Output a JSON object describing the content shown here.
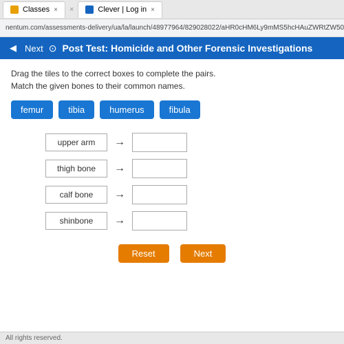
{
  "browser": {
    "tab1_favicon": "classes",
    "tab1_label": "Classes",
    "tab1_close": "×",
    "tab2_favicon": "clever",
    "tab2_label": "Clever | Log in",
    "tab2_close": "×",
    "address": "nentum.com/assessments-delivery/ua/la/launch/48977964/829028022/aHR0cHM6Ly9mMS5hcHAuZWRtZW50dW0"
  },
  "page": {
    "nav_back": "◀",
    "nav_label": "Next",
    "nav_icon": "⊙",
    "title": "Post Test: Homicide and Other Forensic Investigations"
  },
  "content": {
    "instruction_main": "Drag the tiles to the correct boxes to complete the pairs.",
    "instruction_sub": "Match the given bones to their common names.",
    "tiles": [
      {
        "id": "femur",
        "label": "femur"
      },
      {
        "id": "tibia",
        "label": "tibia"
      },
      {
        "id": "humerus",
        "label": "humerus"
      },
      {
        "id": "fibula",
        "label": "fibula"
      }
    ],
    "pairs": [
      {
        "id": "upper-arm",
        "label": "upper arm"
      },
      {
        "id": "thigh-bone",
        "label": "thigh bone"
      },
      {
        "id": "calf-bone",
        "label": "calf bone"
      },
      {
        "id": "shinbone",
        "label": "shinbone"
      }
    ],
    "buttons": {
      "reset": "Reset",
      "next": "Next"
    }
  },
  "footer": {
    "text": "All rights reserved."
  }
}
